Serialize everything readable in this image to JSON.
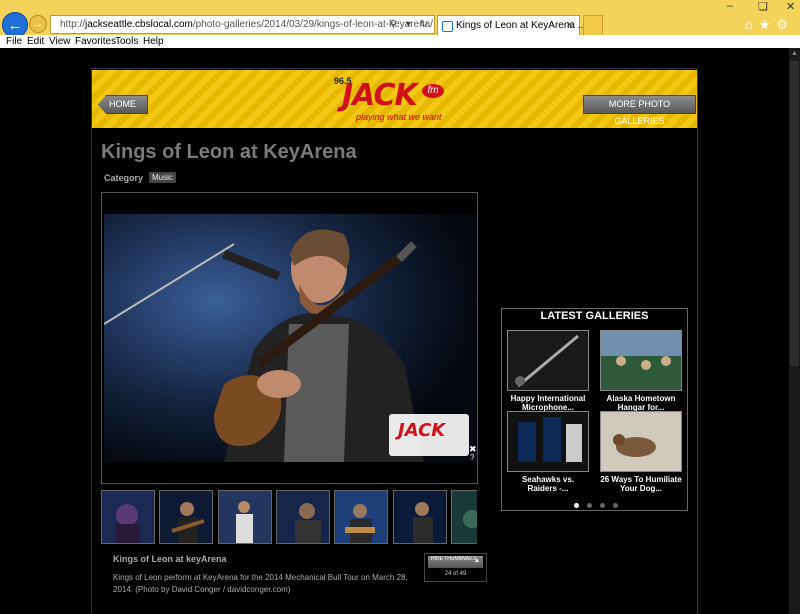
{
  "browser": {
    "url_prefix": "http://",
    "url_host": "jackseattle.cbslocal.com",
    "url_path": "/photo-galleries/2014/03/29/kings-of-leon-at-keyarena/",
    "tab_title": "Kings of Leon at KeyArena ...",
    "menu": [
      "File",
      "Edit",
      "View",
      "Favorites",
      "Tools",
      "Help"
    ]
  },
  "header": {
    "home_label": "HOME",
    "more_label": "MORE PHOTO GALLERIES",
    "logo_number": "96.5",
    "logo_name": "JACK",
    "logo_fm": "fm",
    "logo_tagline": "playing what we want"
  },
  "gallery": {
    "title": "Kings of Leon at KeyArena",
    "category_label": "Category",
    "category_value": "Music",
    "caption_title": "Kings of Leon at keyArena",
    "caption_body": "Kings of Leon perform at KeyArena for the 2014 Mechanical Bull Tour on March 28, 2014. (Photo by David Conger / davidconger.com)",
    "hide_label": "HIDE THUMBNAILS",
    "count": "24 of 49"
  },
  "latest": {
    "title": "LATEST GALLERIES",
    "items": [
      {
        "title": "Happy International Microphone..."
      },
      {
        "title": "Alaska Hometown Hangar for..."
      },
      {
        "title": "Seahawks vs. Raiders -..."
      },
      {
        "title": "26 Ways To Humiliate Your Dog..."
      }
    ]
  }
}
